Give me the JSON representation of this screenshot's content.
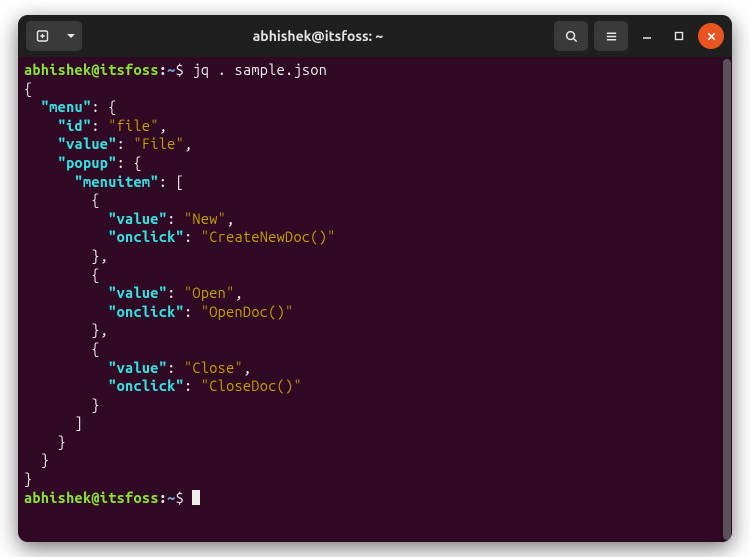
{
  "titlebar": {
    "title": "abhishek@itsfoss: ~"
  },
  "prompt": {
    "user": "abhishek",
    "at": "@",
    "host": "itsfoss",
    "colon": ":",
    "path": "~",
    "dollar": "$"
  },
  "command": "jq . sample.json",
  "prompt2": {
    "user": "abhishek",
    "at": "@",
    "host": "itsfoss",
    "colon": ":",
    "path": "~",
    "dollar": "$"
  },
  "lines": [
    [
      {
        "cls": "plain",
        "t": "{"
      }
    ],
    [
      {
        "cls": "plain",
        "t": "  "
      },
      {
        "cls": "jkey",
        "t": "\"menu\""
      },
      {
        "cls": "plain",
        "t": ": {"
      }
    ],
    [
      {
        "cls": "plain",
        "t": "    "
      },
      {
        "cls": "jkey",
        "t": "\"id\""
      },
      {
        "cls": "plain",
        "t": ": "
      },
      {
        "cls": "jstr",
        "t": "\"file\""
      },
      {
        "cls": "plain",
        "t": ","
      }
    ],
    [
      {
        "cls": "plain",
        "t": "    "
      },
      {
        "cls": "jkey",
        "t": "\"value\""
      },
      {
        "cls": "plain",
        "t": ": "
      },
      {
        "cls": "jstr",
        "t": "\"File\""
      },
      {
        "cls": "plain",
        "t": ","
      }
    ],
    [
      {
        "cls": "plain",
        "t": "    "
      },
      {
        "cls": "jkey",
        "t": "\"popup\""
      },
      {
        "cls": "plain",
        "t": ": {"
      }
    ],
    [
      {
        "cls": "plain",
        "t": "      "
      },
      {
        "cls": "jkey",
        "t": "\"menuitem\""
      },
      {
        "cls": "plain",
        "t": ": ["
      }
    ],
    [
      {
        "cls": "plain",
        "t": "        {"
      }
    ],
    [
      {
        "cls": "plain",
        "t": "          "
      },
      {
        "cls": "jkey",
        "t": "\"value\""
      },
      {
        "cls": "plain",
        "t": ": "
      },
      {
        "cls": "jstr",
        "t": "\"New\""
      },
      {
        "cls": "plain",
        "t": ","
      }
    ],
    [
      {
        "cls": "plain",
        "t": "          "
      },
      {
        "cls": "jkey",
        "t": "\"onclick\""
      },
      {
        "cls": "plain",
        "t": ": "
      },
      {
        "cls": "jstr",
        "t": "\"CreateNewDoc()\""
      }
    ],
    [
      {
        "cls": "plain",
        "t": "        },"
      }
    ],
    [
      {
        "cls": "plain",
        "t": "        {"
      }
    ],
    [
      {
        "cls": "plain",
        "t": "          "
      },
      {
        "cls": "jkey",
        "t": "\"value\""
      },
      {
        "cls": "plain",
        "t": ": "
      },
      {
        "cls": "jstr",
        "t": "\"Open\""
      },
      {
        "cls": "plain",
        "t": ","
      }
    ],
    [
      {
        "cls": "plain",
        "t": "          "
      },
      {
        "cls": "jkey",
        "t": "\"onclick\""
      },
      {
        "cls": "plain",
        "t": ": "
      },
      {
        "cls": "jstr",
        "t": "\"OpenDoc()\""
      }
    ],
    [
      {
        "cls": "plain",
        "t": "        },"
      }
    ],
    [
      {
        "cls": "plain",
        "t": "        {"
      }
    ],
    [
      {
        "cls": "plain",
        "t": "          "
      },
      {
        "cls": "jkey",
        "t": "\"value\""
      },
      {
        "cls": "plain",
        "t": ": "
      },
      {
        "cls": "jstr",
        "t": "\"Close\""
      },
      {
        "cls": "plain",
        "t": ","
      }
    ],
    [
      {
        "cls": "plain",
        "t": "          "
      },
      {
        "cls": "jkey",
        "t": "\"onclick\""
      },
      {
        "cls": "plain",
        "t": ": "
      },
      {
        "cls": "jstr",
        "t": "\"CloseDoc()\""
      }
    ],
    [
      {
        "cls": "plain",
        "t": "        }"
      }
    ],
    [
      {
        "cls": "plain",
        "t": "      ]"
      }
    ],
    [
      {
        "cls": "plain",
        "t": "    }"
      }
    ],
    [
      {
        "cls": "plain",
        "t": "  }"
      }
    ],
    [
      {
        "cls": "plain",
        "t": "}"
      }
    ]
  ]
}
